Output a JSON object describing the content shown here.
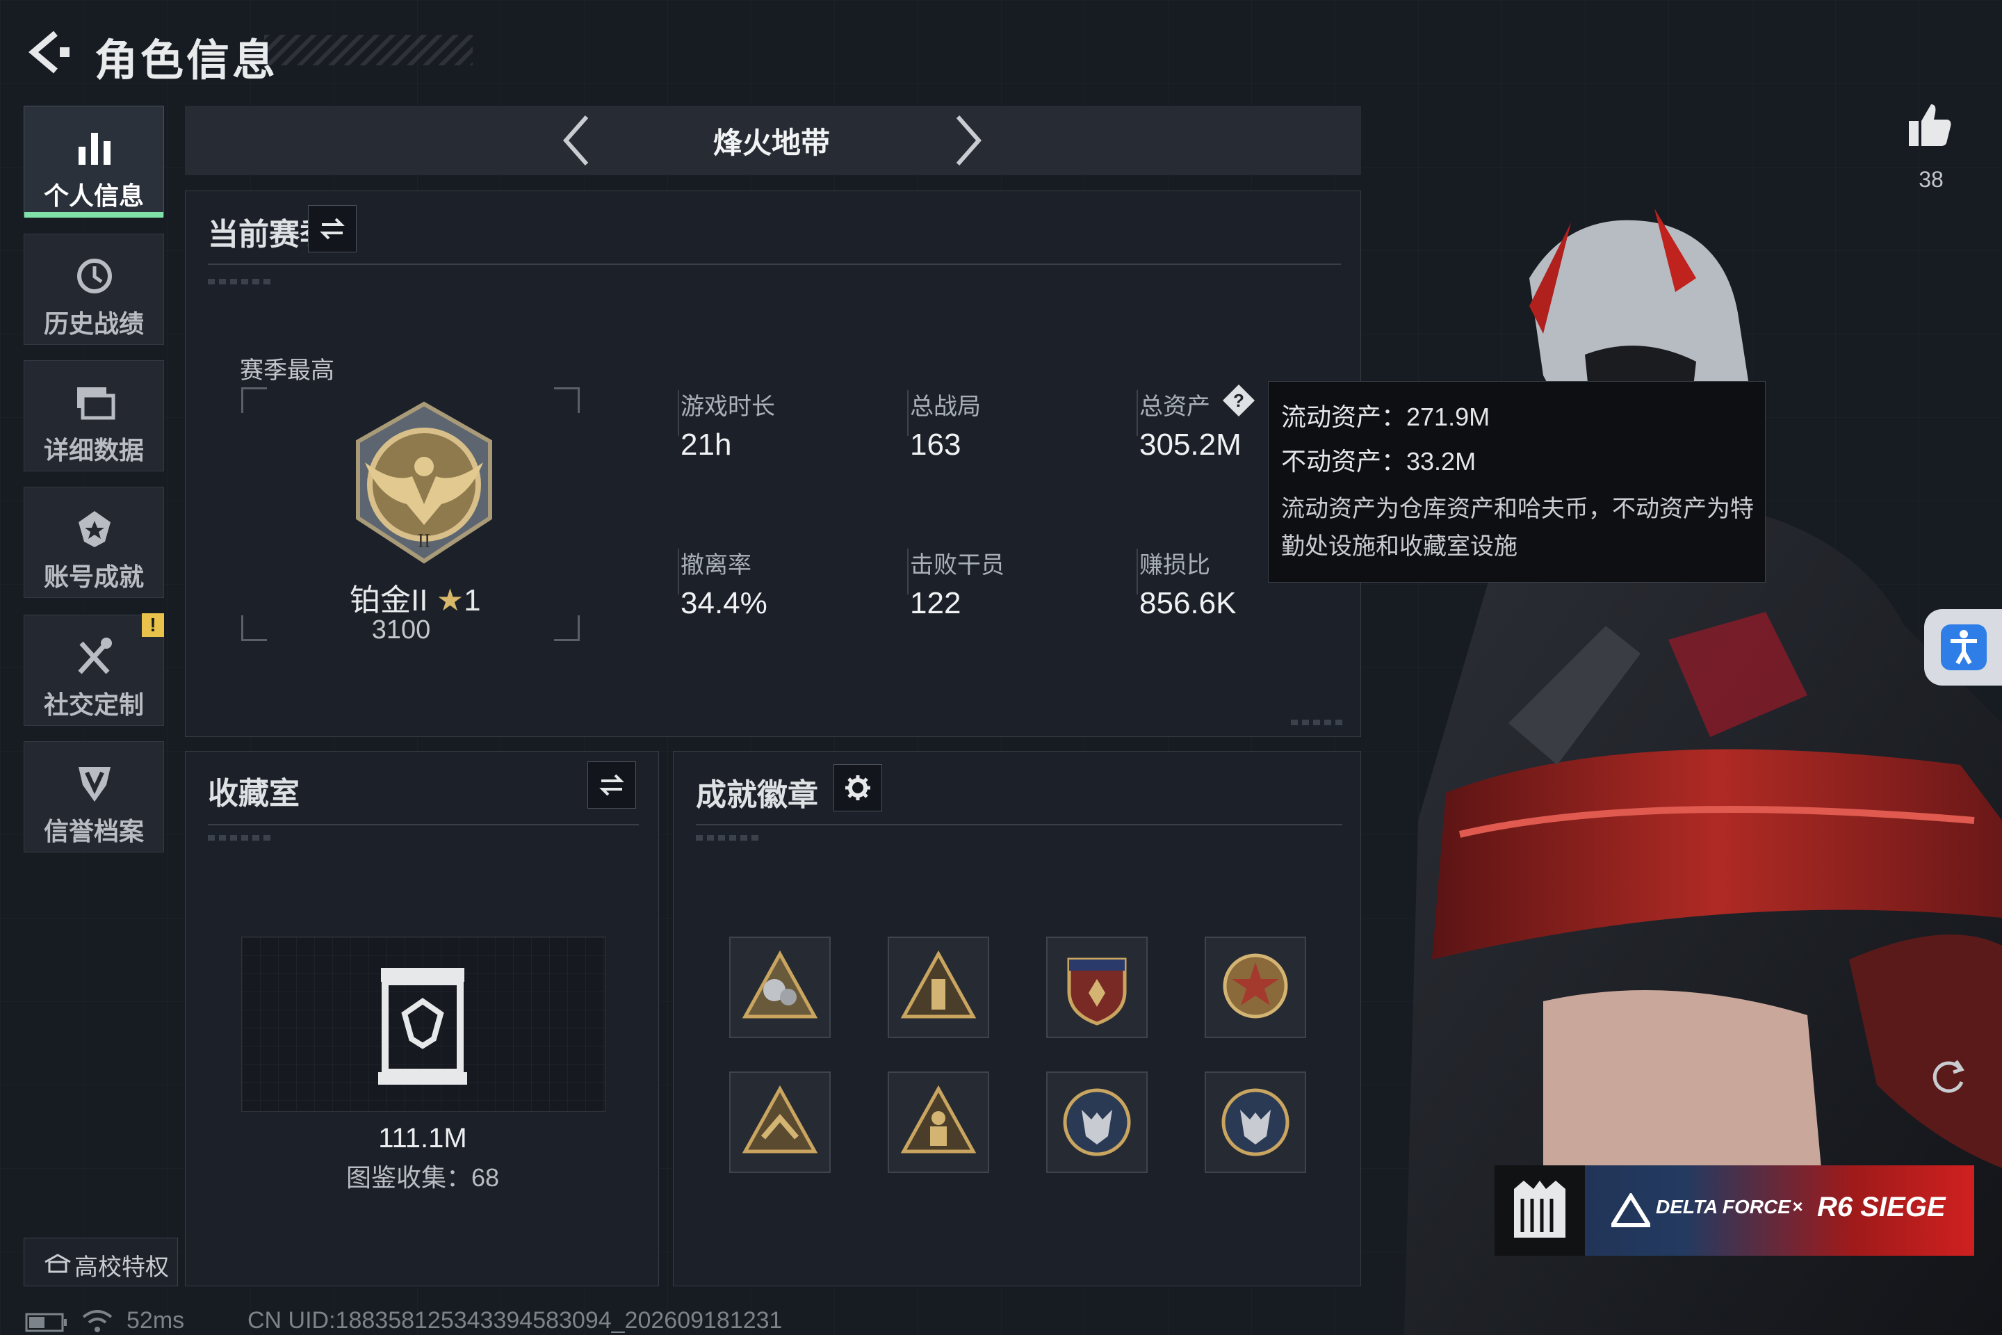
{
  "header": {
    "title": "角色信息"
  },
  "sidebar": {
    "items": [
      {
        "label": "个人信息",
        "icon": "bar-chart-icon",
        "active": true
      },
      {
        "label": "历史战绩",
        "icon": "history-clock-icon",
        "active": false
      },
      {
        "label": "详细数据",
        "icon": "data-cards-icon",
        "active": false
      },
      {
        "label": "账号成就",
        "icon": "achievement-star-icon",
        "active": false
      },
      {
        "label": "社交定制",
        "icon": "tools-icon",
        "active": false,
        "alert": "!"
      },
      {
        "label": "信誉档案",
        "icon": "credit-shield-icon",
        "active": false
      }
    ],
    "campus": {
      "label": "高校特权",
      "icon": "campus-icon"
    }
  },
  "mode": {
    "title": "烽火地带"
  },
  "season": {
    "title": "当前赛季",
    "best_label": "赛季最高",
    "rank_name": "铂金II",
    "rank_stars": "1",
    "rank_score": "3100",
    "stats": [
      {
        "label": "游戏时长",
        "value": "21h"
      },
      {
        "label": "总战局",
        "value": "163"
      },
      {
        "label": "总资产",
        "value": "305.2M",
        "help": "?"
      },
      {
        "label": "撤离率",
        "value": "34.4%"
      },
      {
        "label": "击败干员",
        "value": "122"
      },
      {
        "label": "赚损比",
        "value": "856.6K"
      }
    ]
  },
  "tooltip": {
    "liquid": "流动资产：271.9M",
    "fixed": "不动资产：33.2M",
    "note": "流动资产为仓库资产和哈夫币，不动资产为特勤处设施和收藏室设施"
  },
  "collection": {
    "title": "收藏室",
    "value": "111.1M",
    "count_text": "图鉴收集：68"
  },
  "achievements": {
    "title": "成就徽章",
    "badges": [
      "gears-triangle-badge",
      "tower-triangle-badge",
      "eagle-shield-badge",
      "star-roundel-badge",
      "chevron-triangle-badge",
      "soldier-triangle-badge",
      "wolf-round-badge",
      "wolf-round-badge-2"
    ]
  },
  "social": {
    "likes": "38"
  },
  "banner": {
    "left": "DELTA FORCE",
    "x": "×",
    "right": "R6 SIEGE"
  },
  "status": {
    "ping": "52ms",
    "uid": "CN UID:18835812534339458309​4_202609181231"
  },
  "colors": {
    "accent": "#7fe0a8",
    "alert": "#e8c24a",
    "background": "#171b22"
  }
}
